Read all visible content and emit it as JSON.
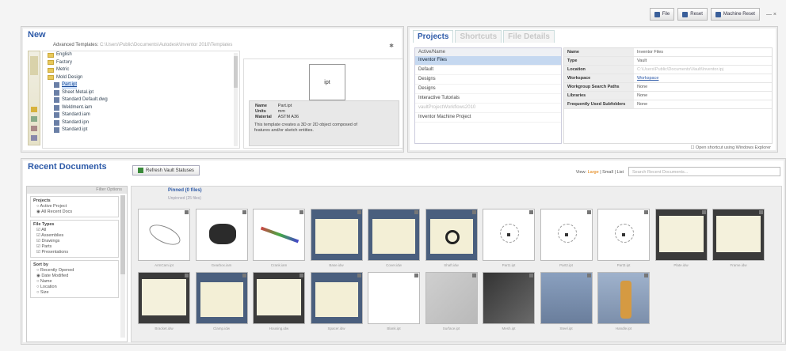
{
  "toolbar": {
    "btn1": "File",
    "btn2": "Reset",
    "btn3": "Machine Reset",
    "win": "— ×"
  },
  "new_panel": {
    "title": "New",
    "templates_label": "Advanced Templates:",
    "templates_path": "C:\\Users\\Public\\Documents\\Autodesk\\Inventor 2010\\Templates",
    "tree": [
      "English",
      "Factory",
      "Metric",
      "Mold Design",
      "Part.ipt",
      "Sheet Metal.ipt",
      "Standard  Default.dwg",
      "Weldment.iam",
      "Standard.iam",
      "Standard.ipn",
      "Standard.ipt"
    ],
    "preview_label": "ipt",
    "props": [
      {
        "k": "Name",
        "v": "Part.ipt"
      },
      {
        "k": "Units",
        "v": "mm"
      },
      {
        "k": "Material",
        "v": "ASTM A36"
      }
    ],
    "desc": "This template creates a 3D or 2D object composed of features and/or sketch entities."
  },
  "projects_panel": {
    "tabs": [
      "Projects",
      "Shortcuts",
      "File Details"
    ],
    "list_head": "Active/Name",
    "items": [
      "Inventor Files",
      "Default",
      "Designs",
      "Designs",
      "Interactive Tutorials",
      "vaultProjectWorkflows2010",
      "Inventor Machine Project"
    ],
    "props": [
      {
        "k": "Name",
        "v": "Inventor Files"
      },
      {
        "k": "Type",
        "v": "Vault"
      },
      {
        "k": "Location",
        "v": "C:\\Users\\Public\\Documents\\Vault\\Inventor.ipj"
      },
      {
        "k": "Workspace",
        "v": "Workspace"
      },
      {
        "k": "Workgroup Search Paths",
        "v": "None"
      },
      {
        "k": "Libraries",
        "v": "None"
      },
      {
        "k": "Frequently Used Subfolders",
        "v": "None"
      }
    ],
    "checkbox": "Open shortcut using Windows Explorer"
  },
  "recent_panel": {
    "title": "Recent Documents",
    "refresh": "Refresh Vault Statuses",
    "view_prefix": "View:",
    "view_large": "Large",
    "view_small": "Small",
    "view_list": "List",
    "search_placeholder": "Search Recent Documents...",
    "filter_head": "Filter Options",
    "projects_box": {
      "h": "Projects",
      "o": [
        "Active Project",
        "All Recent Docs"
      ]
    },
    "types_box": {
      "h": "File Types",
      "o": [
        "All",
        "Assemblies",
        "Drawings",
        "Parts",
        "Presentations"
      ]
    },
    "sort_box": {
      "h": "Sort by",
      "o": [
        "Recently Opened",
        "Date Modified",
        "Name",
        "Location",
        "Size"
      ]
    },
    "gallery_head": "Pinned (0 files)",
    "gallery_sub": "Unpinned (25 files)",
    "captions": [
      "ArmCam.ipt",
      "Gearbox.iam",
      "Crank.iam",
      "Base.idw",
      "Cover.idw",
      "Shaft.idw",
      "Part1.ipt",
      "Part2.ipt",
      "Part3.ipt",
      "Plate.idw",
      "Frame.idw",
      "Bracket.idw",
      "Clamp.idw",
      "Housing.idw",
      "Spacer.idw",
      "Blank.ipt",
      "Surface.ipt",
      "Mesh.ipt",
      "Steel.ipt",
      "Handle.ipt"
    ]
  }
}
